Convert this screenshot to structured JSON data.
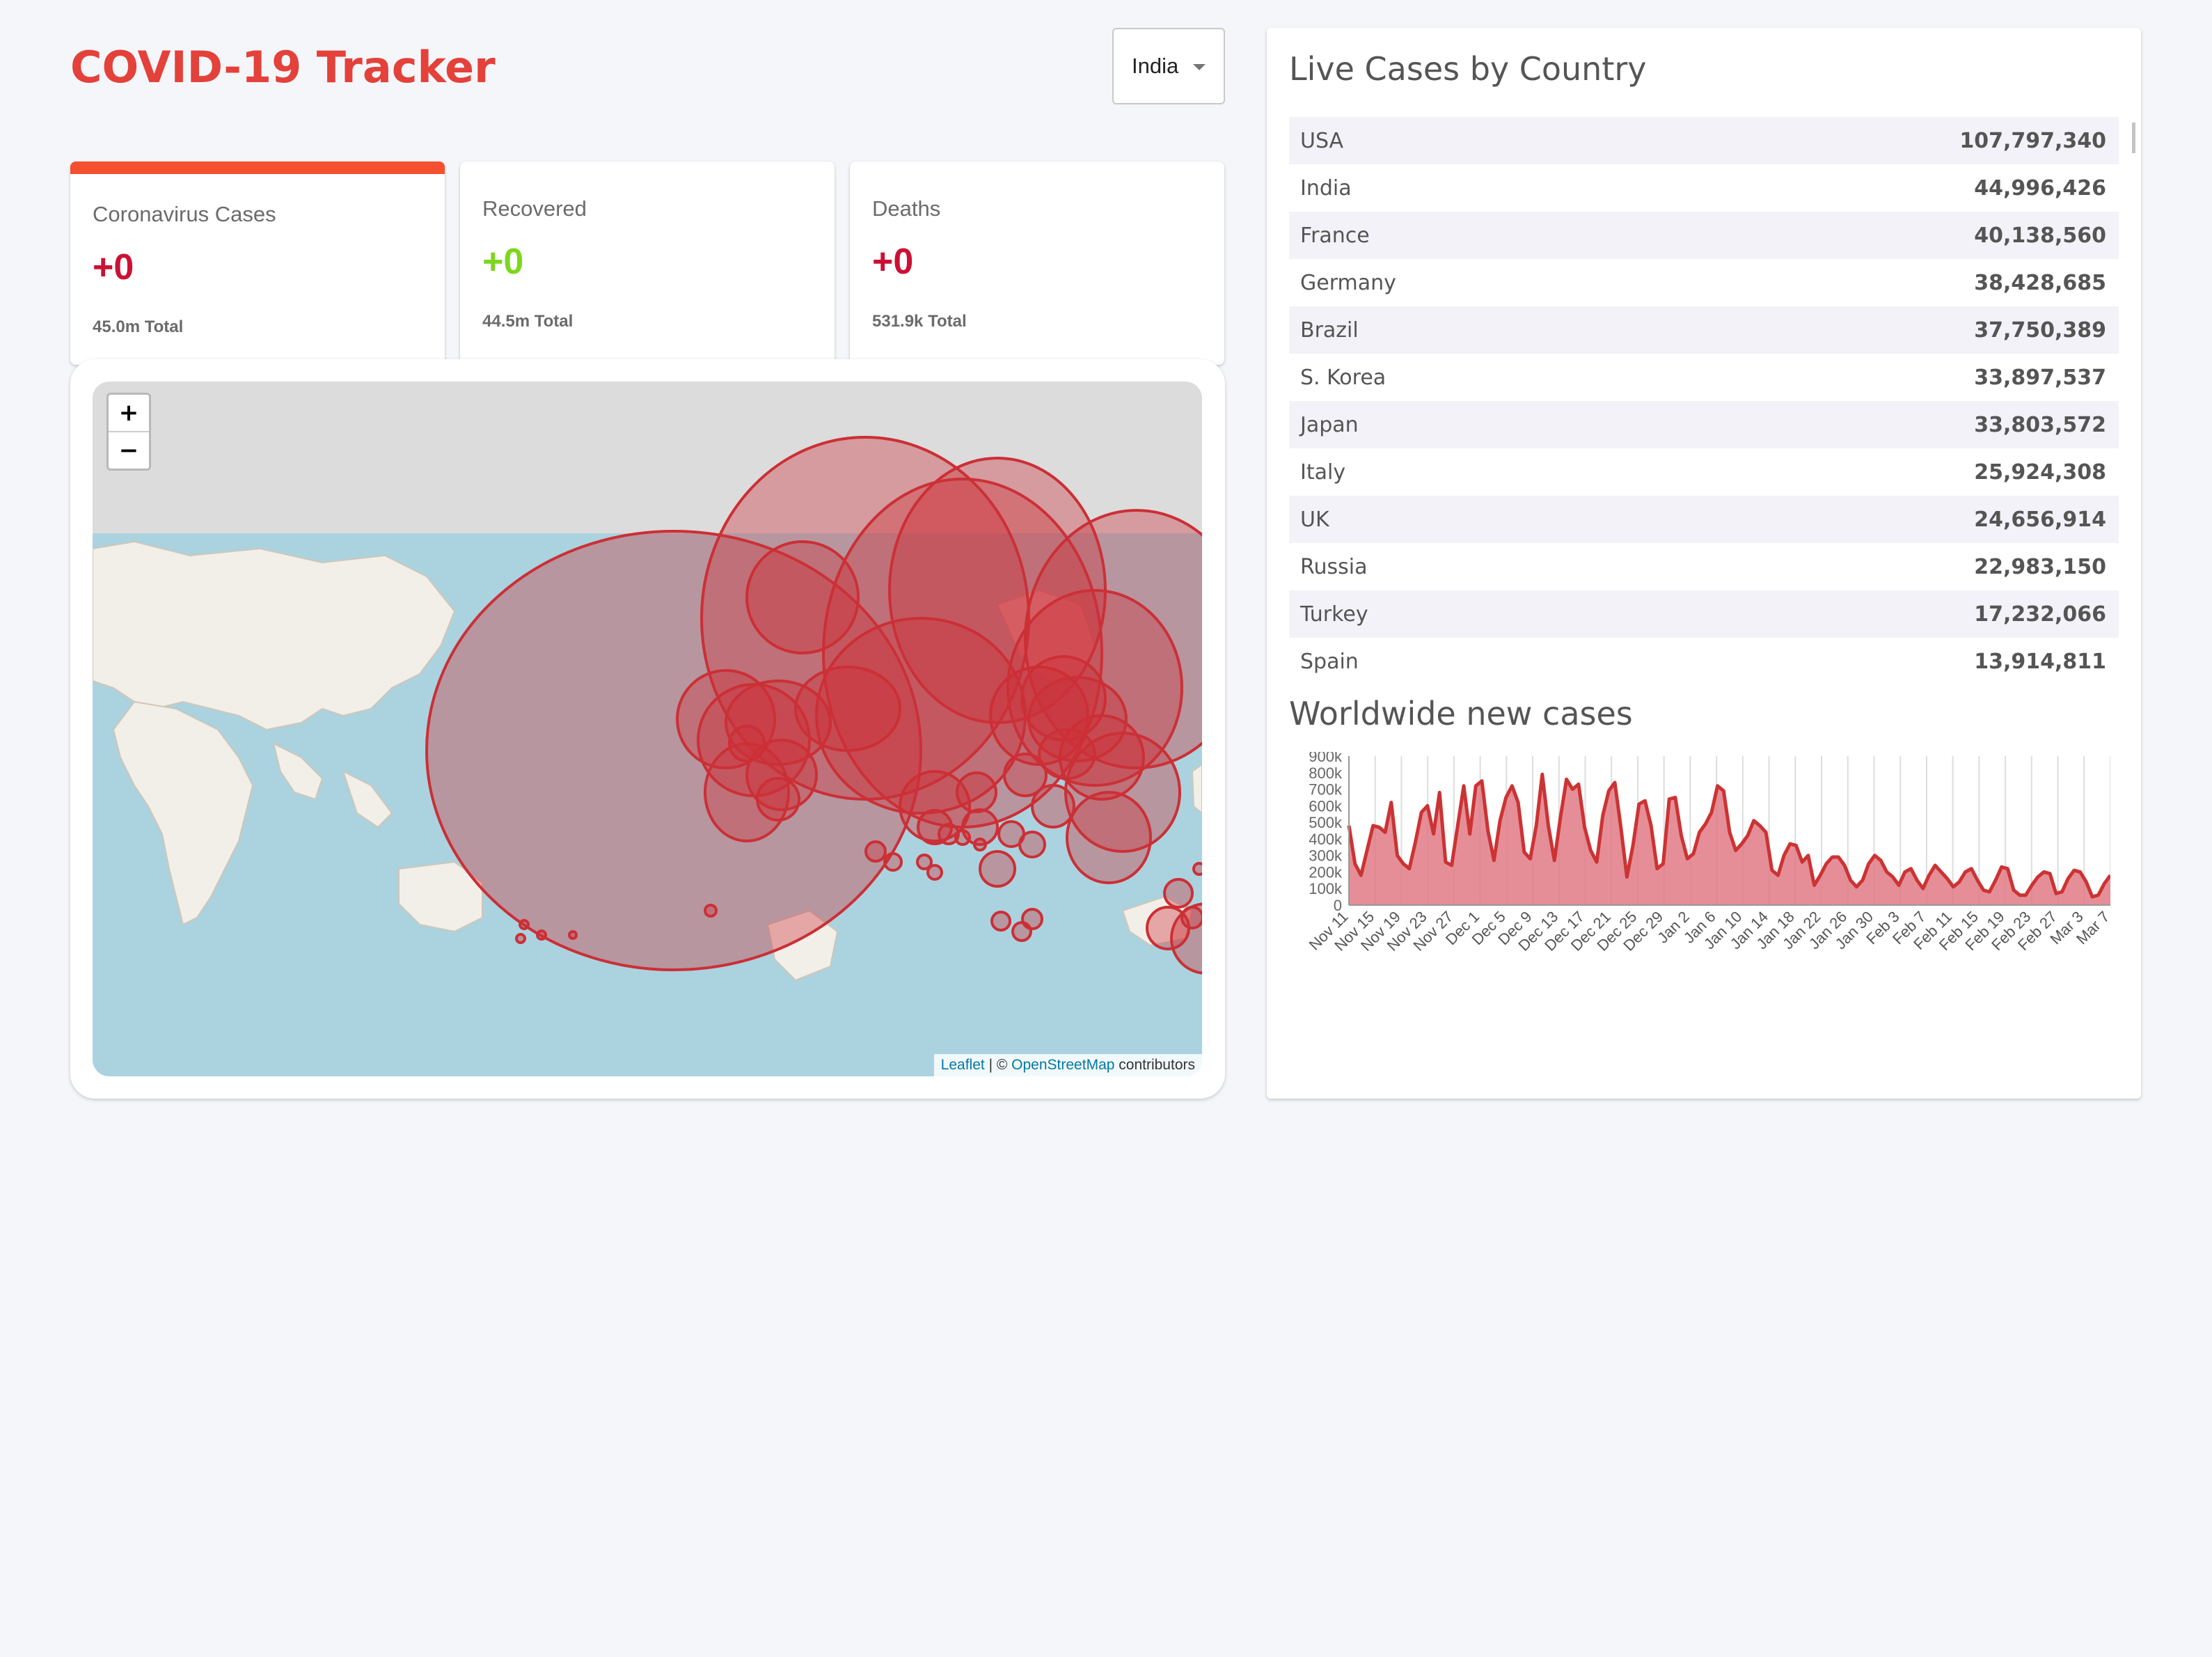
{
  "app": {
    "title": "COVID-19 Tracker"
  },
  "country_select": {
    "value": "India"
  },
  "stats": [
    {
      "label": "Coronavirus Cases",
      "value": "+0",
      "total": "45.0m Total",
      "selected": true
    },
    {
      "label": "Recovered",
      "value": "+0",
      "total": "44.5m Total",
      "selected": false
    },
    {
      "label": "Deaths",
      "value": "+0",
      "total": "531.9k Total",
      "selected": false
    }
  ],
  "map": {
    "zoom_in": "+",
    "zoom_out": "−",
    "attribution": {
      "leaflet": "Leaflet",
      "separator": " | © ",
      "osm": "OpenStreetMap",
      "suffix": " contributors"
    }
  },
  "live_cases": {
    "title": "Live Cases by Country",
    "rows": [
      {
        "country": "USA",
        "cases": "107,797,340"
      },
      {
        "country": "India",
        "cases": "44,996,426"
      },
      {
        "country": "France",
        "cases": "40,138,560"
      },
      {
        "country": "Germany",
        "cases": "38,428,685"
      },
      {
        "country": "Brazil",
        "cases": "37,750,389"
      },
      {
        "country": "S. Korea",
        "cases": "33,897,537"
      },
      {
        "country": "Japan",
        "cases": "33,803,572"
      },
      {
        "country": "Italy",
        "cases": "25,924,308"
      },
      {
        "country": "UK",
        "cases": "24,656,914"
      },
      {
        "country": "Russia",
        "cases": "22,983,150"
      },
      {
        "country": "Turkey",
        "cases": "17,232,066"
      },
      {
        "country": "Spain",
        "cases": "13,914,811"
      }
    ]
  },
  "chart_title": "Worldwide new cases",
  "colors": {
    "title": "#e3413a",
    "cases": "#cc1034",
    "recovered": "#7dd71d",
    "selected_bar": "#f4502f",
    "area_fill": "#e07a85",
    "area_line": "#cc3333"
  },
  "chart_data": {
    "type": "area",
    "title": "",
    "xlabel": "",
    "ylabel": "",
    "ylim": [
      0,
      900000
    ],
    "y_ticks": [
      "0",
      "100k",
      "200k",
      "300k",
      "400k",
      "500k",
      "600k",
      "700k",
      "800k",
      "900k"
    ],
    "x_tick_labels": [
      "Nov 11",
      "Nov 15",
      "Nov 19",
      "Nov 23",
      "Nov 27",
      "Dec 1",
      "Dec 5",
      "Dec 9",
      "Dec 13",
      "Dec 17",
      "Dec 21",
      "Dec 25",
      "Dec 29",
      "Jan 2",
      "Jan 6",
      "Jan 10",
      "Jan 14",
      "Jan 18",
      "Jan 22",
      "Jan 26",
      "Jan 30",
      "Feb 3",
      "Feb 7",
      "Feb 11",
      "Feb 15",
      "Feb 19",
      "Feb 23",
      "Feb 27",
      "Mar 3",
      "Mar 7"
    ],
    "series": [
      {
        "values": [
          480000,
          250000,
          180000,
          330000,
          480000,
          470000,
          440000,
          620000,
          300000,
          250000,
          220000,
          380000,
          560000,
          600000,
          430000,
          680000,
          260000,
          240000,
          480000,
          720000,
          430000,
          720000,
          750000,
          450000,
          270000,
          510000,
          650000,
          720000,
          620000,
          320000,
          280000,
          480000,
          790000,
          480000,
          270000,
          530000,
          760000,
          700000,
          730000,
          470000,
          330000,
          260000,
          540000,
          690000,
          740000,
          470000,
          170000,
          360000,
          610000,
          630000,
          480000,
          220000,
          250000,
          640000,
          650000,
          420000,
          280000,
          310000,
          440000,
          490000,
          560000,
          720000,
          690000,
          440000,
          330000,
          370000,
          420000,
          510000,
          480000,
          440000,
          210000,
          180000,
          300000,
          370000,
          360000,
          260000,
          300000,
          120000,
          180000,
          250000,
          290000,
          290000,
          240000,
          150000,
          110000,
          150000,
          250000,
          300000,
          270000,
          200000,
          170000,
          120000,
          200000,
          220000,
          150000,
          100000,
          180000,
          240000,
          200000,
          160000,
          110000,
          140000,
          200000,
          220000,
          150000,
          90000,
          80000,
          150000,
          230000,
          220000,
          90000,
          60000,
          60000,
          120000,
          170000,
          200000,
          190000,
          70000,
          80000,
          160000,
          210000,
          200000,
          140000,
          50000,
          60000,
          130000,
          180000
        ]
      }
    ]
  }
}
